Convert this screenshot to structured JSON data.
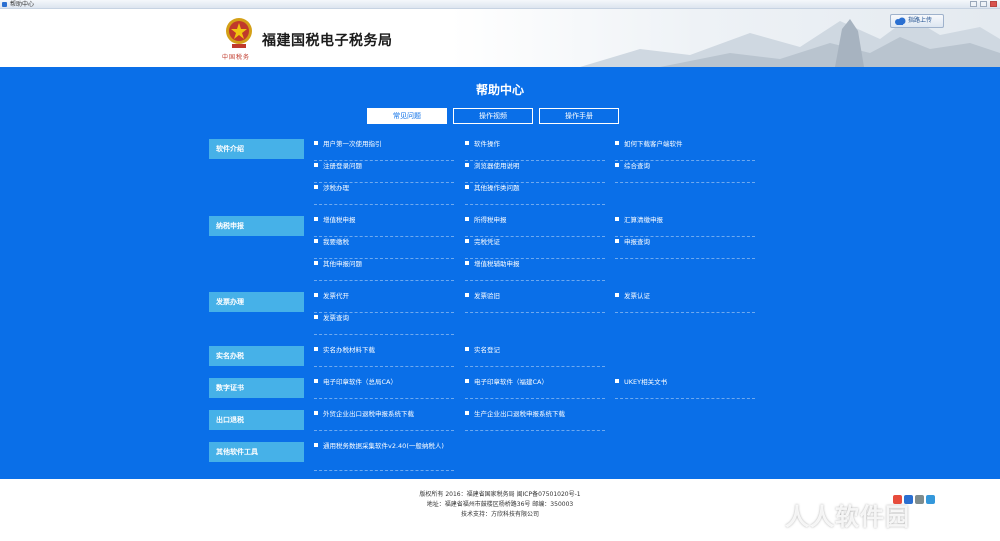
{
  "window": {
    "title": "帮助中心"
  },
  "header": {
    "site_title": "福建国税电子税务局",
    "emblem_caption": "中国税务",
    "share_label": "指路上传"
  },
  "main": {
    "title": "帮助中心",
    "tabs": [
      {
        "label": "常见问题",
        "active": true
      },
      {
        "label": "操作视频",
        "active": false
      },
      {
        "label": "操作手册",
        "active": false
      }
    ],
    "categories": [
      {
        "label": "软件介绍",
        "items": [
          "用户第一次使用指引",
          "软件操作",
          "如何下载客户端软件",
          "注册登录问题",
          "浏览器使用说明",
          "综合查询",
          "涉税办理",
          "其他操作类问题"
        ]
      },
      {
        "label": "纳税申报",
        "items": [
          "增值税申报",
          "所得税申报",
          "汇算清缴申报",
          "我要缴税",
          "完税凭证",
          "申报查询",
          "其他申报问题",
          "增值税辅助申报"
        ]
      },
      {
        "label": "发票办理",
        "items": [
          "发票代开",
          "发票验旧",
          "发票认证",
          "发票查询"
        ]
      },
      {
        "label": "实名办税",
        "items": [
          "实名办税材料下载",
          "实名登记"
        ]
      },
      {
        "label": "数字证书",
        "items": [
          "电子印章软件（总局CA）",
          "电子印章软件（福建CA）",
          "UKEY相关文书"
        ]
      },
      {
        "label": "出口退税",
        "items": [
          "外贸企业出口退税申报系统下载",
          "生产企业出口退税申报系统下载"
        ]
      },
      {
        "label": "其他软件工具",
        "items": [
          "通用税务数据采集软件v2.40(一般纳税人)"
        ]
      }
    ]
  },
  "footer": {
    "copyright": "版权所有 2016：福建省国家税务局 闽ICP备07501020号-1",
    "address": "地址：福建省福州市鼓楼区杨桥路36号 邮编：350003",
    "support": "技术支持：方欣科技有限公司"
  },
  "watermark": "人人软件园",
  "colors": {
    "main_bg": "#0a6fe8",
    "category_bg": "#46b1e8",
    "tab_active_bg": "#ffffff"
  }
}
